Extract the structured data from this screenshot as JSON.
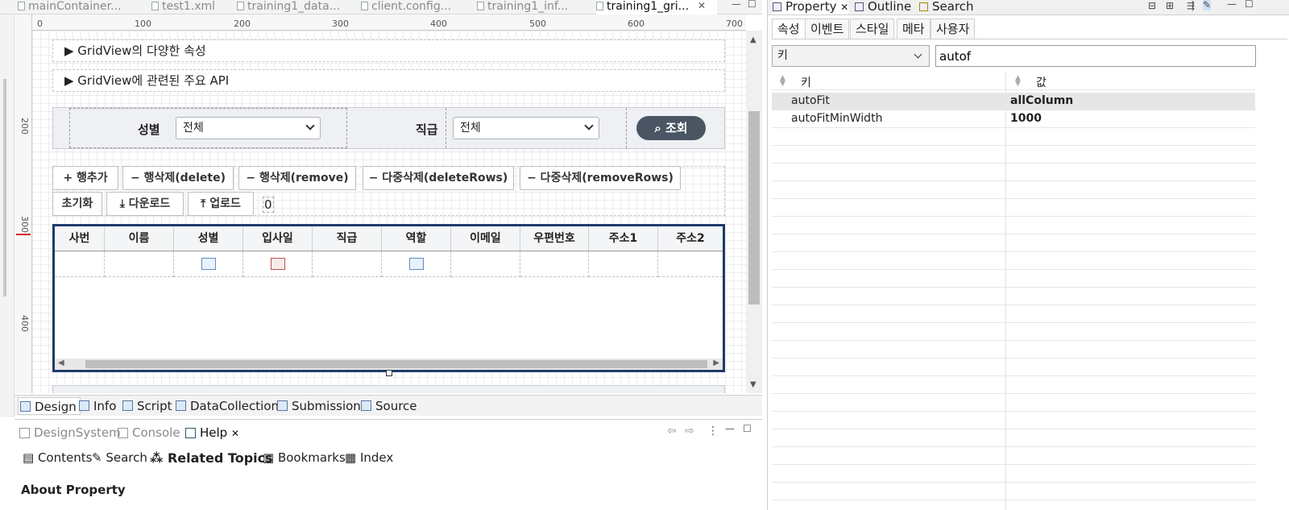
{
  "editor_tabs": [
    {
      "label": "mainContainer..."
    },
    {
      "label": "test1.xml"
    },
    {
      "label": "training1_data..."
    },
    {
      "label": "client.config..."
    },
    {
      "label": "training1_inf..."
    },
    {
      "label": "training1_gri..."
    }
  ],
  "ruler": {
    "h": [
      "0",
      "100",
      "200",
      "300",
      "400",
      "500",
      "600",
      "700"
    ],
    "v": [
      "200",
      "300",
      "400"
    ]
  },
  "canvas": {
    "accordion": [
      "▶ GridView의 다양한 속성",
      "▶ GridView에 관련된 주요 API"
    ],
    "search": {
      "gender_label": "성별",
      "gender_value": "전체",
      "rank_label": "직급",
      "rank_value": "전체",
      "search_button": "조회"
    },
    "buttons_row1": [
      "+ 행추가",
      "− 행삭제(delete)",
      "− 행삭제(remove)",
      "− 다중삭제(deleteRows)",
      "− 다중삭제(removeRows)"
    ],
    "buttons_row2": [
      "초기화",
      "다운로드",
      "업로드"
    ],
    "count": "0",
    "grid_columns": [
      "사번",
      "이름",
      "성별",
      "입사일",
      "직급",
      "역할",
      "이메일",
      "우편번호",
      "주소1",
      "주소2"
    ]
  },
  "design_tabs": [
    "Design",
    "Info",
    "Script",
    "DataCollection",
    "Submission",
    "Source"
  ],
  "bottom_tabs": [
    "DesignSystem",
    "Console",
    "Help"
  ],
  "help": {
    "links": [
      "Contents",
      "Search",
      "Related Topics",
      "Bookmarks",
      "Index"
    ],
    "heading": "About Property"
  },
  "right_panel": {
    "views": [
      "Property",
      "Outline",
      "Search"
    ],
    "tabs": [
      "속성",
      "이벤트",
      "스타일",
      "메타",
      "사용자"
    ],
    "key_select": "키",
    "filter_value": "autof",
    "col_key": "키",
    "col_value": "값",
    "rows": [
      {
        "key": "autoFit",
        "value": "allColumn"
      },
      {
        "key": "autoFitMinWidth",
        "value": "1000"
      }
    ]
  }
}
